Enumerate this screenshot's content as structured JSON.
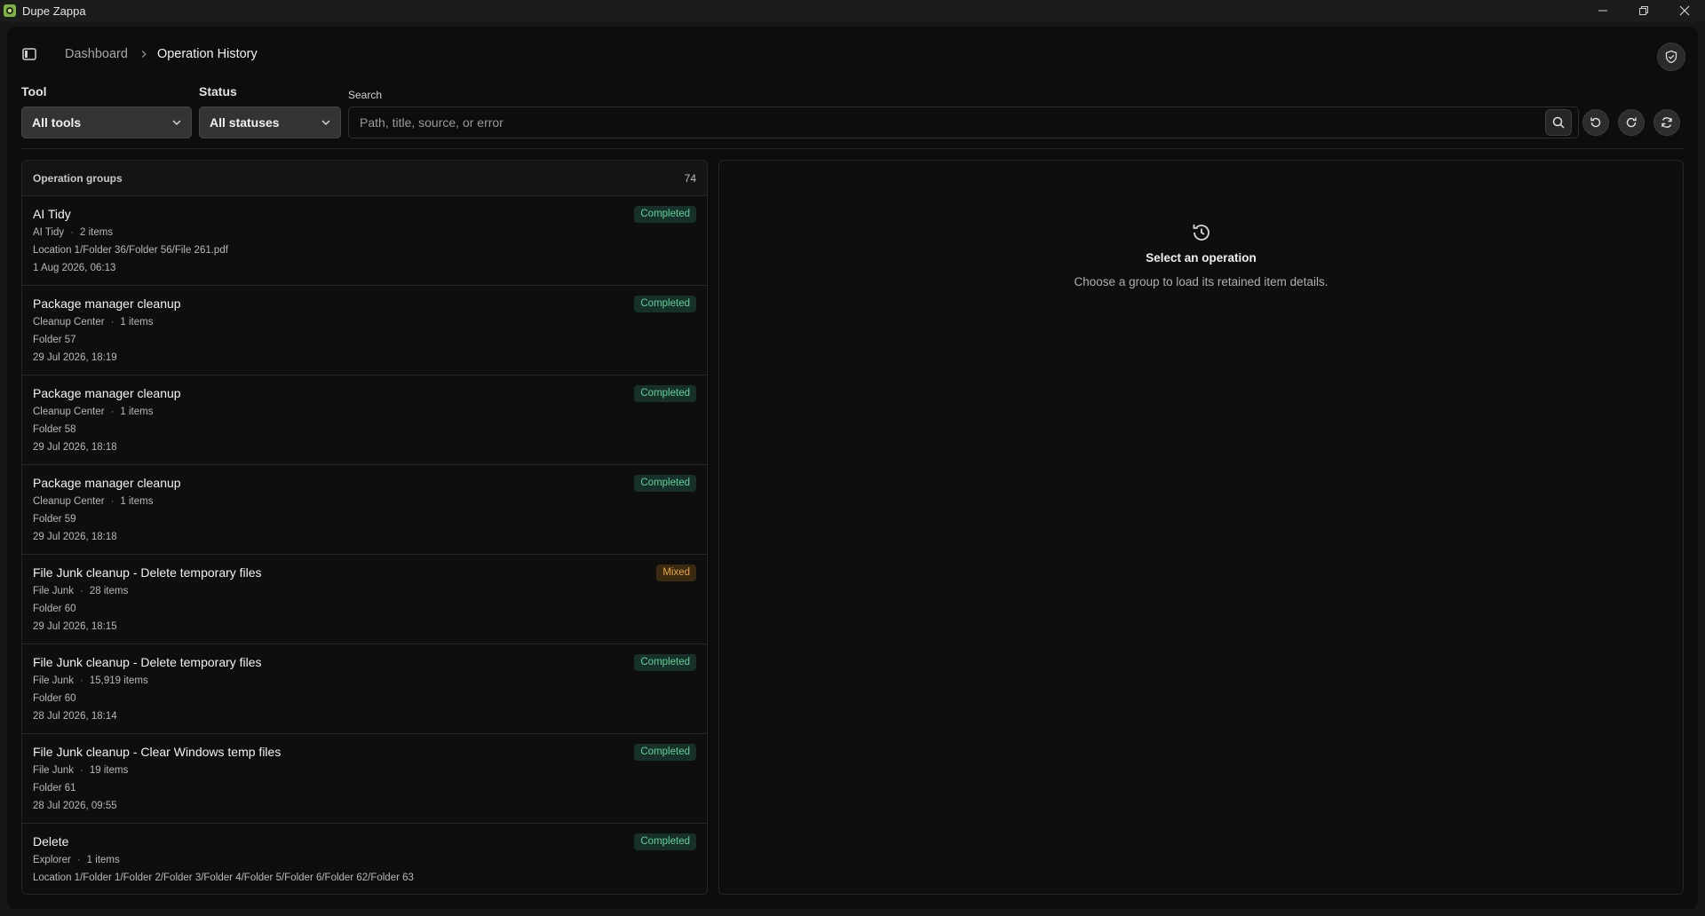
{
  "window": {
    "title": "Dupe Zappa"
  },
  "breadcrumb": {
    "parent": "Dashboard",
    "current": "Operation History"
  },
  "filters": {
    "tool_label": "Tool",
    "tool_value": "All tools",
    "status_label": "Status",
    "status_value": "All statuses",
    "search_label": "Search",
    "search_placeholder": "Path, title, source, or error",
    "search_value": ""
  },
  "groups_panel": {
    "title": "Operation groups",
    "count": "74",
    "groups": [
      {
        "title": "AI Tidy",
        "tool": "AI Tidy",
        "items": "2 items",
        "path": "Location 1/Folder 36/Folder 56/File 261.pdf",
        "date": "1 Aug 2026, 06:13",
        "status": "Completed"
      },
      {
        "title": "Package manager cleanup",
        "tool": "Cleanup Center",
        "items": "1 items",
        "path": "Folder 57",
        "date": "29 Jul 2026, 18:19",
        "status": "Completed"
      },
      {
        "title": "Package manager cleanup",
        "tool": "Cleanup Center",
        "items": "1 items",
        "path": "Folder 58",
        "date": "29 Jul 2026, 18:18",
        "status": "Completed"
      },
      {
        "title": "Package manager cleanup",
        "tool": "Cleanup Center",
        "items": "1 items",
        "path": "Folder 59",
        "date": "29 Jul 2026, 18:18",
        "status": "Completed"
      },
      {
        "title": "File Junk cleanup - Delete temporary files",
        "tool": "File Junk",
        "items": "28 items",
        "path": "Folder 60",
        "date": "29 Jul 2026, 18:15",
        "status": "Mixed"
      },
      {
        "title": "File Junk cleanup - Delete temporary files",
        "tool": "File Junk",
        "items": "15,919 items",
        "path": "Folder 60",
        "date": "28 Jul 2026, 18:14",
        "status": "Completed"
      },
      {
        "title": "File Junk cleanup - Clear Windows temp files",
        "tool": "File Junk",
        "items": "19 items",
        "path": "Folder 61",
        "date": "28 Jul 2026, 09:55",
        "status": "Completed"
      },
      {
        "title": "Delete",
        "tool": "Explorer",
        "items": "1 items",
        "path": "Location 1/Folder 1/Folder 2/Folder 3/Folder 4/Folder 5/Folder 6/Folder 62/Folder 63",
        "date": "",
        "status": "Completed"
      }
    ]
  },
  "detail": {
    "empty_title": "Select an operation",
    "empty_subtitle": "Choose a group to load its retained item details."
  },
  "icons": {
    "app": "app-logo-icon",
    "sidebar": "sidebar-toggle-icon",
    "shield": "shield-check-icon",
    "search": "search-icon",
    "undo": "undo-icon",
    "redo": "redo-icon",
    "refresh": "refresh-icon",
    "history": "history-icon"
  },
  "colors": {
    "completed_text": "#5fd19a",
    "completed_bg": "#17302a",
    "mixed_text": "#e7a63d",
    "mixed_bg": "#3a2a10"
  }
}
